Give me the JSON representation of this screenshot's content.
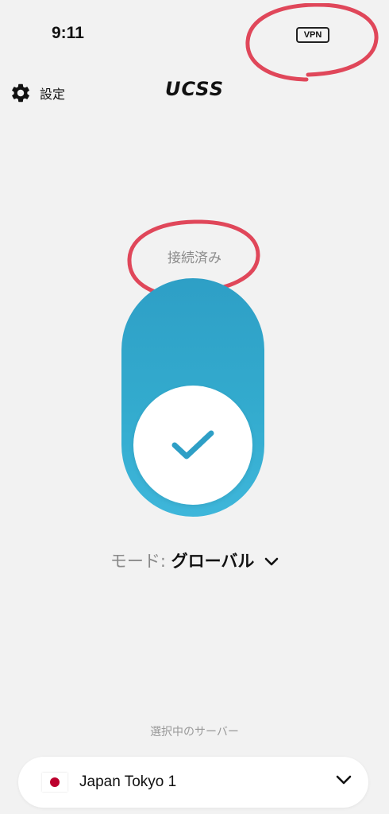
{
  "status_bar": {
    "time": "9:11",
    "vpn_badge": "VPN"
  },
  "header": {
    "settings_label": "設定",
    "logo": "UCSS"
  },
  "connection": {
    "status": "接続済み",
    "connected": true,
    "toggle_color": "#33abce"
  },
  "mode": {
    "label": "モード:",
    "value": "グローバル"
  },
  "server": {
    "caption": "選択中のサーバー",
    "name": "Japan Tokyo 1",
    "flag": "japan-flag"
  },
  "annotations": {
    "circle_color": "#e0475a"
  }
}
